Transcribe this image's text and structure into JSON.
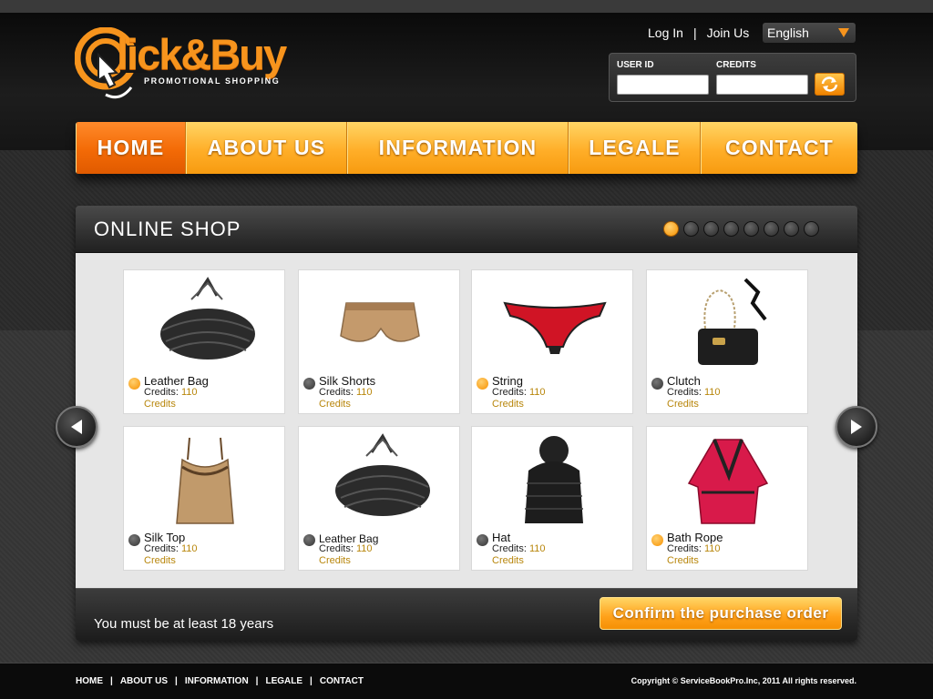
{
  "brand": {
    "name": "lick&Buy",
    "tagline": "PROMOTIONAL SHOPPING",
    "accent": "#f7941d"
  },
  "top_links": {
    "login": "Log In",
    "separator": "|",
    "join": "Join Us"
  },
  "language": {
    "selected": "English"
  },
  "login_box": {
    "user_id_label": "USER ID",
    "credits_label": "CREDITS",
    "refresh_icon": "refresh-icon"
  },
  "nav": {
    "items": [
      {
        "label": "HOME",
        "active": true
      },
      {
        "label": "ABOUT US",
        "active": false
      },
      {
        "label": "INFORMATION",
        "active": false
      },
      {
        "label": "LEGALE",
        "active": false
      },
      {
        "label": "CONTACT",
        "active": false
      }
    ]
  },
  "shop": {
    "title": "ONLINE SHOP",
    "pager_count": 8,
    "pager_active": 1,
    "products": [
      {
        "name": "Leather Bag",
        "credits_label": "Credits:",
        "credits": "110",
        "credits_unit": "Credits",
        "highlight": true
      },
      {
        "name": "Silk Shorts",
        "credits_label": "Credits:",
        "credits": "110",
        "credits_unit": "Credits",
        "highlight": false
      },
      {
        "name": "String",
        "credits_label": "Credits:",
        "credits": "110",
        "credits_unit": "Credits",
        "highlight": true
      },
      {
        "name": "Clutch",
        "credits_label": "Credits:",
        "credits": "110",
        "credits_unit": "Credits",
        "highlight": false
      },
      {
        "name": "Silk Top",
        "credits_label": "Credits:",
        "credits": "110",
        "credits_unit": "Credits",
        "highlight": false
      },
      {
        "name": "Leather Bag",
        "credits_label": "Credits:",
        "credits": "110",
        "credits_unit": "Credits",
        "highlight": false
      },
      {
        "name": "Hat",
        "credits_label": "Credits:",
        "credits": "110",
        "credits_unit": "Credits",
        "highlight": false
      },
      {
        "name": "Bath Rope",
        "credits_label": "Credits:",
        "credits": "110",
        "credits_unit": "Credits",
        "highlight": true
      }
    ],
    "age_note": "You must be at least 18 years",
    "confirm_label": "Confirm the purchase order"
  },
  "footer": {
    "links": [
      "HOME",
      "ABOUT US",
      "INFORMATION",
      "LEGALE",
      "CONTACT"
    ],
    "separator": "|",
    "copyright": "Copyright © ServiceBookPro.Inc, 2011 All rights reserved."
  }
}
